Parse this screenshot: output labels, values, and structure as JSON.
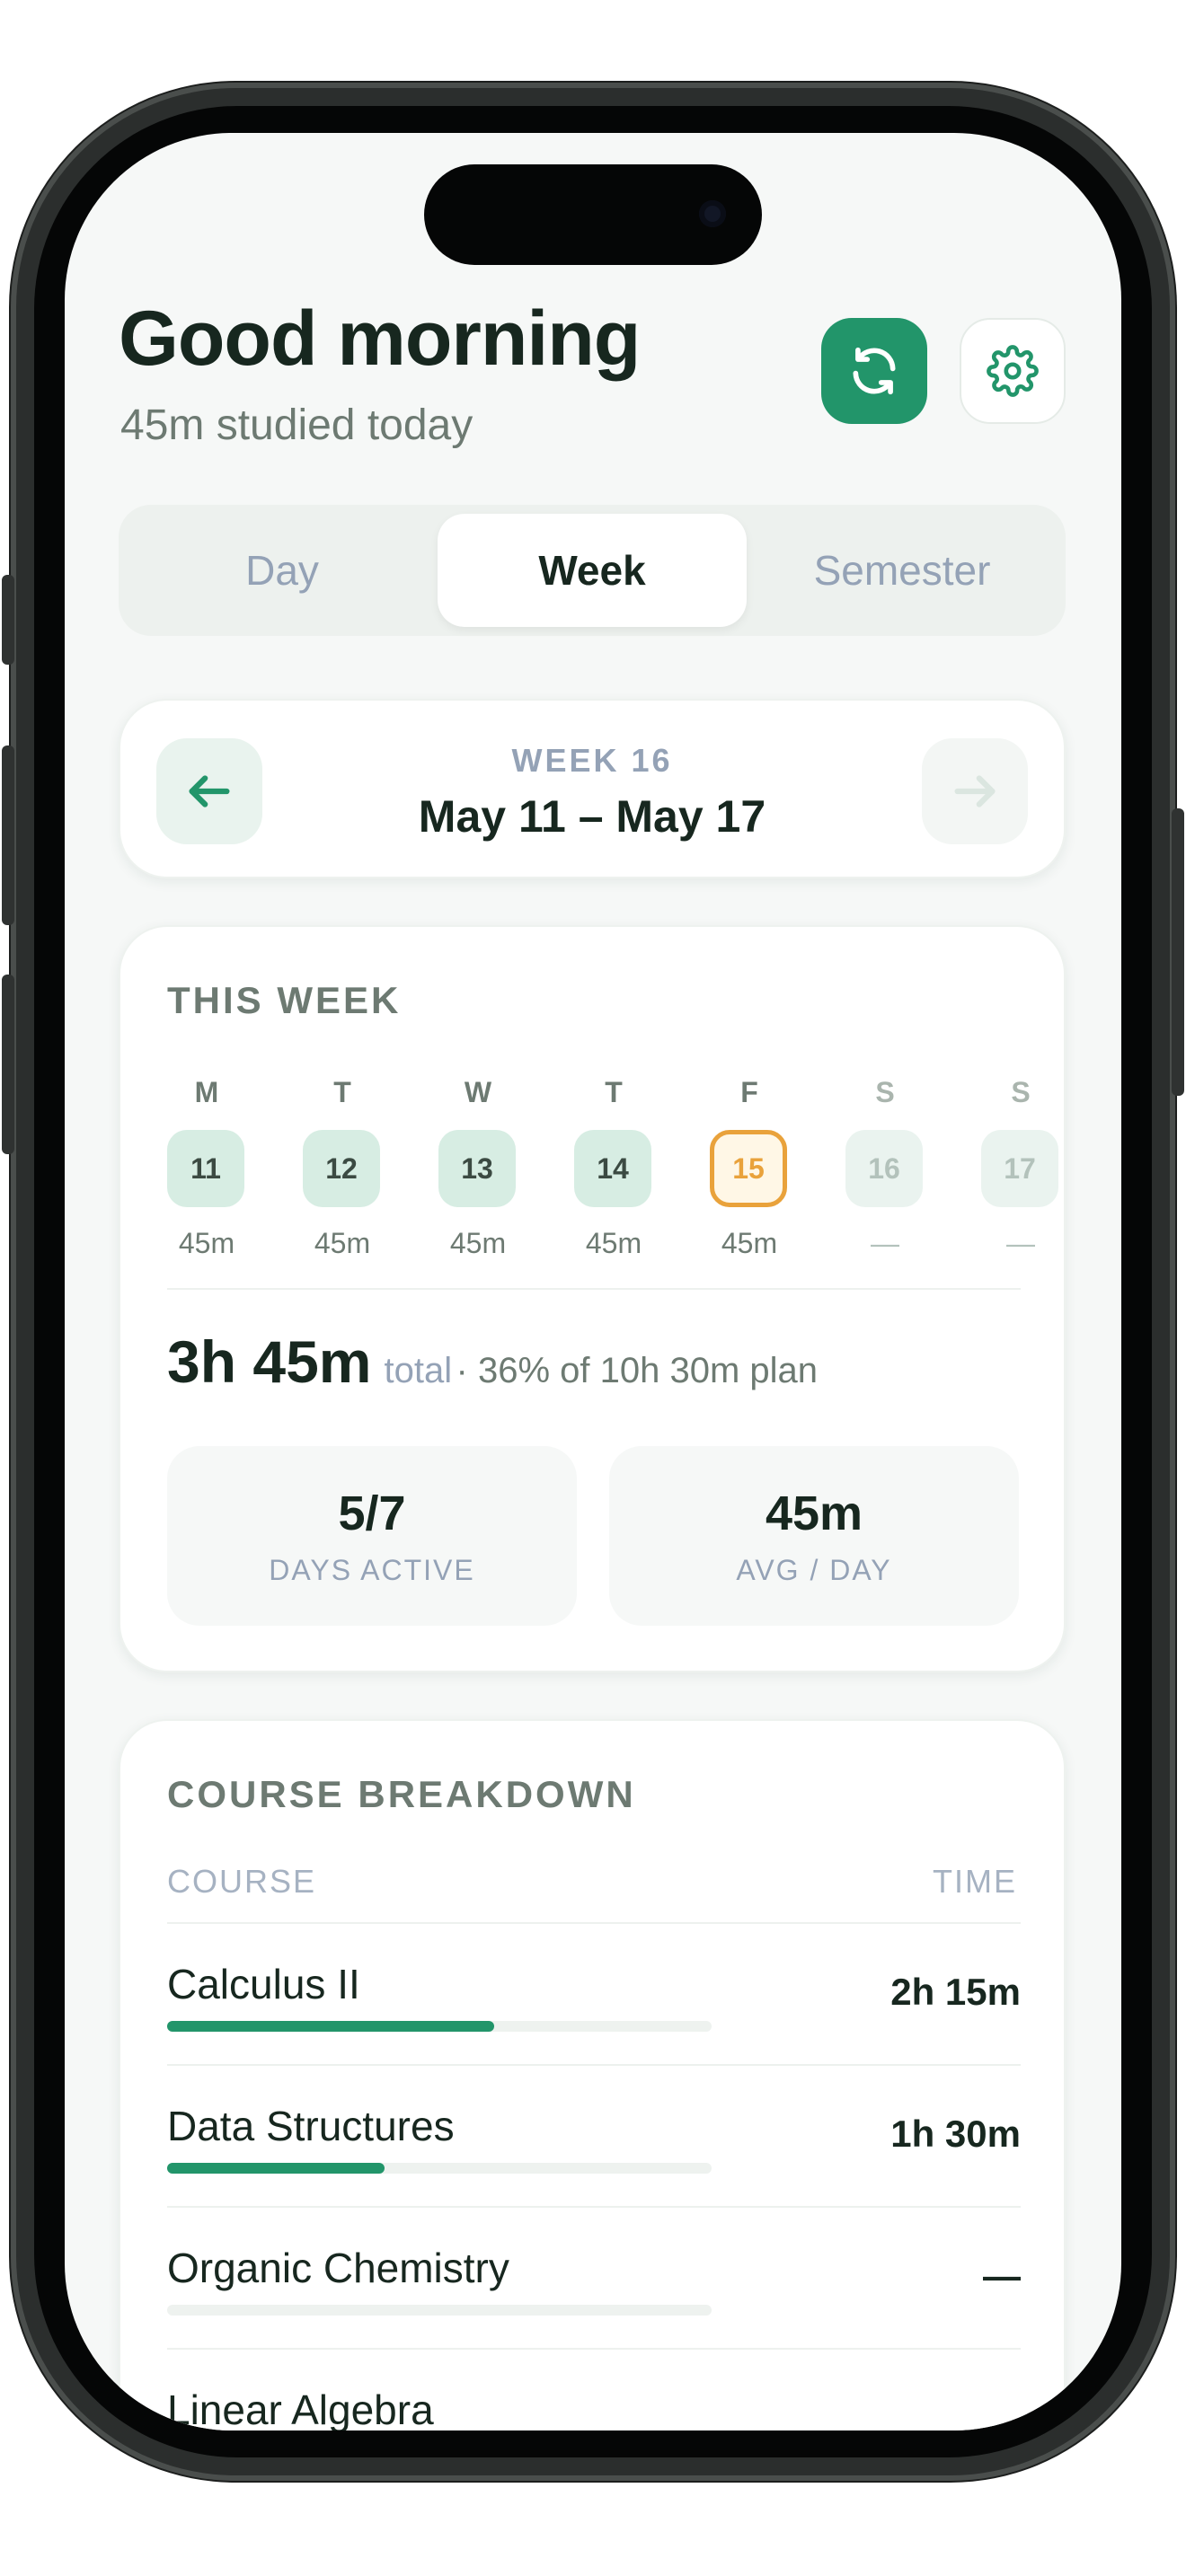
{
  "header": {
    "greeting": "Good morning",
    "subtitle": "45m studied today",
    "sync_icon": "sync-icon",
    "settings_icon": "gear-icon"
  },
  "tabs": [
    {
      "label": "Day",
      "selected": false
    },
    {
      "label": "Week",
      "selected": true
    },
    {
      "label": "Semester",
      "selected": false
    }
  ],
  "week_nav": {
    "label": "WEEK 16",
    "range": "May 11 – May 17",
    "prev_icon": "arrow-left-icon",
    "next_icon": "arrow-right-icon",
    "next_enabled": false
  },
  "this_week": {
    "title": "THIS WEEK",
    "days": [
      {
        "letter": "M",
        "date": "11",
        "time": "45m",
        "state": "studied"
      },
      {
        "letter": "T",
        "date": "12",
        "time": "45m",
        "state": "studied"
      },
      {
        "letter": "W",
        "date": "13",
        "time": "45m",
        "state": "studied"
      },
      {
        "letter": "T",
        "date": "14",
        "time": "45m",
        "state": "studied"
      },
      {
        "letter": "F",
        "date": "15",
        "time": "45m",
        "state": "today"
      },
      {
        "letter": "S",
        "date": "16",
        "time": "—",
        "state": "future"
      },
      {
        "letter": "S",
        "date": "17",
        "time": "—",
        "state": "future"
      }
    ],
    "total_value": "3h 45m",
    "total_word": "total",
    "plan_text": "· 36% of 10h 30m plan",
    "stats": [
      {
        "value": "5/7",
        "label": "DAYS ACTIVE"
      },
      {
        "value": "45m",
        "label": "AVG / DAY"
      }
    ]
  },
  "breakdown": {
    "title": "COURSE BREAKDOWN",
    "col_course": "COURSE",
    "col_time": "TIME",
    "courses": [
      {
        "name": "Calculus II",
        "time": "2h 15m",
        "progress": 0.6
      },
      {
        "name": "Data Structures",
        "time": "1h 30m",
        "progress": 0.4
      },
      {
        "name": "Organic Chemistry",
        "time": "—",
        "progress": 0
      },
      {
        "name": "Linear Algebra",
        "time": "",
        "progress": 0
      }
    ]
  },
  "colors": {
    "accent": "#22956a",
    "today": "#e9a23b",
    "background": "#f6f8f7",
    "text": "#17271f"
  }
}
